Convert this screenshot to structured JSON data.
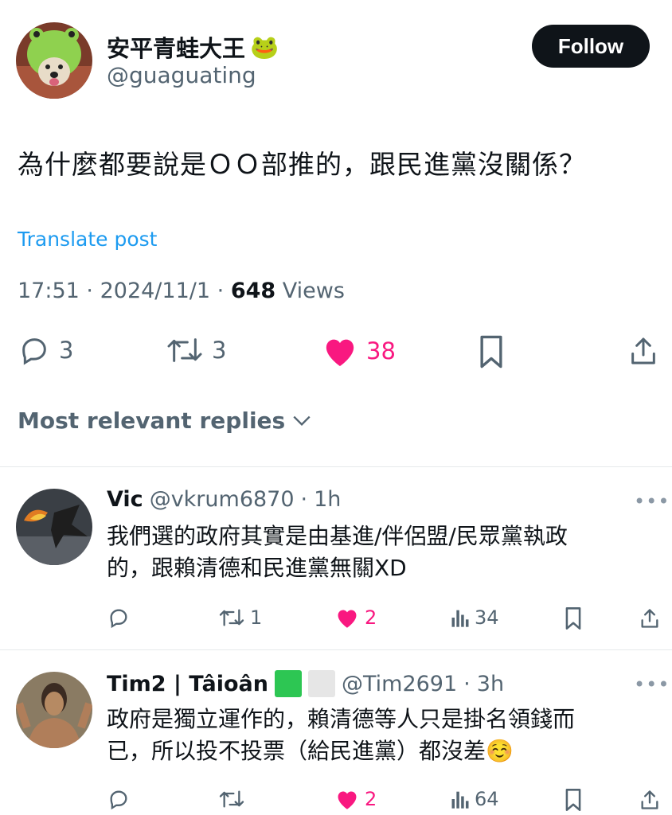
{
  "post": {
    "author_name": "安平青蛙大王",
    "author_emoji": "🐸",
    "handle": "@guaguating",
    "follow_label": "Follow",
    "text": "為什麼都要說是ＯＯ部推的，跟民進黨沒關係？",
    "translate_label": "Translate post",
    "time": "17:51",
    "date": "2024/11/1",
    "sep": "·",
    "views_count": "648",
    "views_label": "Views",
    "replies": "3",
    "reposts": "3",
    "likes": "38"
  },
  "replies_header": "Most relevant replies",
  "replies": [
    {
      "name": "Vic",
      "handle": "@vkrum6870",
      "time": "1h",
      "text_line1": "我們選的政府其實是由基進/伴侶盟/民眾黨執政",
      "text_line2": "的，跟賴清德和民進黨無關XD",
      "reposts": "1",
      "likes": "2",
      "views": "34"
    },
    {
      "name": "Tim2 | Tâioân",
      "handle": "@Tim2691",
      "time": "3h",
      "text_line1": "政府是獨立運作的，賴清德等人只是掛名領錢而",
      "text_line2": "已，所以投不投票（給民進黨）都沒差☺️",
      "likes": "2",
      "views": "64"
    }
  ],
  "colors": {
    "accent": "#1d9bf0",
    "like": "#f91880",
    "muted": "#536471",
    "text": "#0f1419"
  },
  "icons": [
    "reply-icon",
    "repost-icon",
    "heart-icon",
    "bookmark-icon",
    "share-icon",
    "chevron-down-icon",
    "views-icon",
    "more-icon"
  ]
}
